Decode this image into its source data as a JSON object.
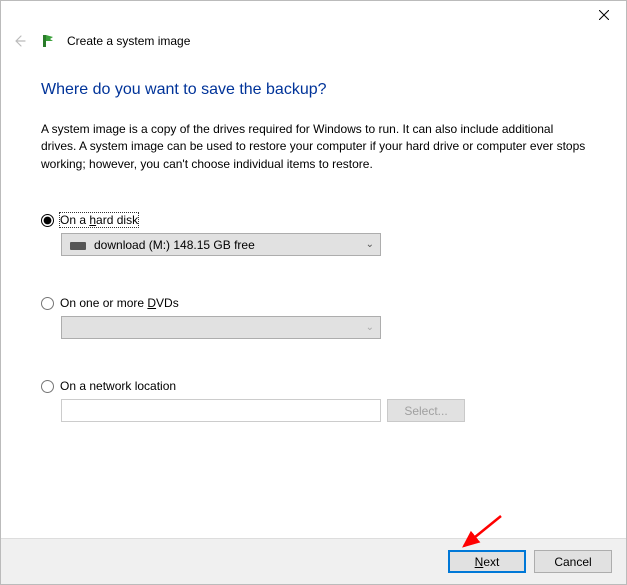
{
  "window": {
    "title": "Create a system image"
  },
  "heading": "Where do you want to save the backup?",
  "description": "A system image is a copy of the drives required for Windows to run. It can also include additional drives. A system image can be used to restore your computer if your hard drive or computer ever stops working; however, you can't choose individual items to restore.",
  "options": {
    "hard_disk": {
      "label_pre": "On a ",
      "label_u": "h",
      "label_post": "ard disk",
      "selected_drive": "download (M:)  148.15 GB free"
    },
    "dvds": {
      "label_pre": "On one or more ",
      "label_u": "D",
      "label_post": "VDs"
    },
    "network": {
      "label": "On a network location",
      "select_button": "Select..."
    }
  },
  "footer": {
    "next_u": "N",
    "next_post": "ext",
    "cancel": "Cancel"
  }
}
